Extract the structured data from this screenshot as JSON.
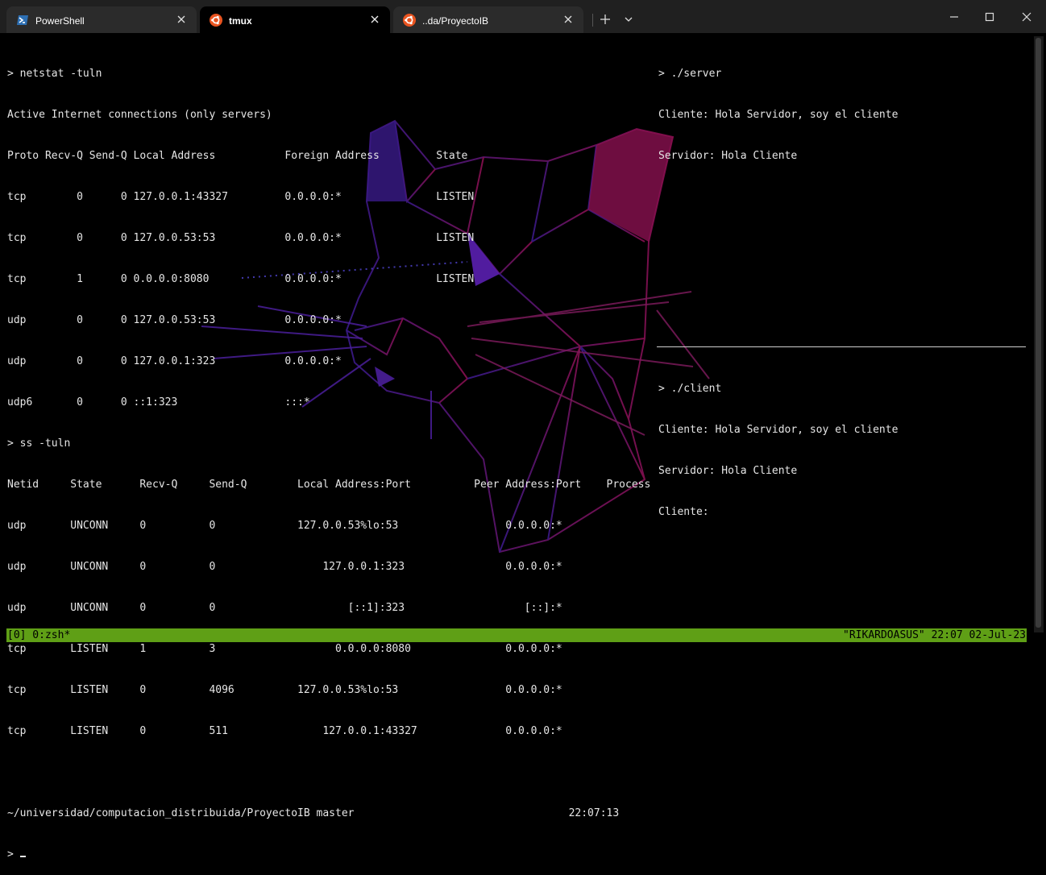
{
  "tabs": [
    {
      "label": "PowerShell",
      "icon": "powershell-icon",
      "active": false
    },
    {
      "label": "tmux",
      "icon": "ubuntu-icon",
      "active": true
    },
    {
      "label": "..da/ProyectoIB",
      "icon": "ubuntu-icon",
      "active": false
    }
  ],
  "colors": {
    "status_bar": "#5f9f16",
    "terminal_bg": "#000000",
    "terminal_fg": "#e6e6e6",
    "ubuntu_orange": "#e95420",
    "titlebar": "#202020"
  },
  "panes": {
    "left": [
      "> netstat -tuln",
      "Active Internet connections (only servers)",
      "Proto Recv-Q Send-Q Local Address           Foreign Address         State",
      "tcp        0      0 127.0.0.1:43327         0.0.0.0:*               LISTEN",
      "tcp        0      0 127.0.0.53:53           0.0.0.0:*               LISTEN",
      "tcp        1      0 0.0.0.0:8080            0.0.0.0:*               LISTEN",
      "udp        0      0 127.0.0.53:53           0.0.0.0:*",
      "udp        0      0 127.0.0.1:323           0.0.0.0:*",
      "udp6       0      0 ::1:323                 :::*",
      "> ss -tuln",
      "Netid     State      Recv-Q     Send-Q        Local Address:Port          Peer Address:Port    Process",
      "udp       UNCONN     0          0             127.0.0.53%lo:53                 0.0.0.0:*",
      "udp       UNCONN     0          0                 127.0.0.1:323                0.0.0.0:*",
      "udp       UNCONN     0          0                     [::1]:323                   [::]:*",
      "tcp       LISTEN     1          3                   0.0.0.0:8080               0.0.0.0:*",
      "tcp       LISTEN     0          4096          127.0.0.53%lo:53                 0.0.0.0:*",
      "tcp       LISTEN     0          511               127.0.0.1:43327              0.0.0.0:*",
      "",
      "~/universidad/computacion_distribuida/ProyectoIB master                                  22:07:13",
      "> "
    ],
    "server": [
      "> ./server",
      "Cliente: Hola Servidor, soy el cliente",
      "Servidor: Hola Cliente"
    ],
    "client": [
      "> ./client",
      "Cliente: Hola Servidor, soy el cliente",
      "Servidor: Hola Cliente",
      "Cliente:"
    ]
  },
  "status": {
    "left": "[0] 0:zsh*",
    "right": "\"RIKARDOASUS\" 22:07 02-Jul-23"
  }
}
